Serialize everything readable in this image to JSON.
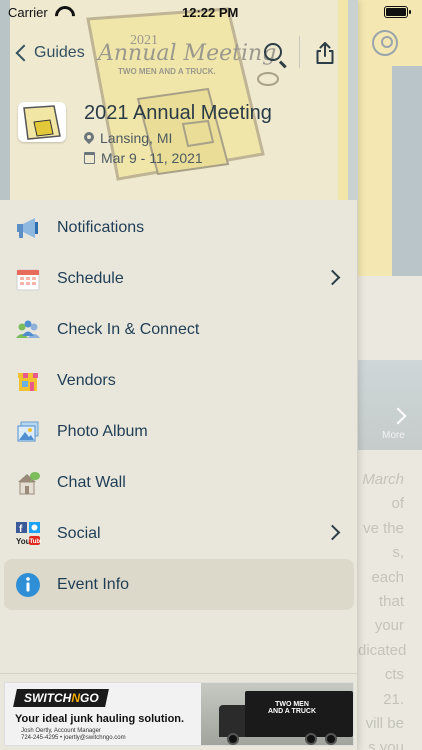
{
  "status_bar": {
    "carrier": "Carrier",
    "time": "12:22 PM"
  },
  "header": {
    "back_label": "Guides",
    "watermark_year": "2021",
    "watermark_title": "Annual Meeting",
    "watermark_sub": "TWO MEN AND A TRUCK.",
    "event_title": "2021 Annual Meeting",
    "event_location": "Lansing, MI",
    "event_dates": "Mar 9 - 11, 2021"
  },
  "menu": {
    "items": [
      {
        "label": "Notifications",
        "icon": "megaphone-icon",
        "chevron": false
      },
      {
        "label": "Schedule",
        "icon": "calendar-icon",
        "chevron": true
      },
      {
        "label": "Check In & Connect",
        "icon": "people-icon",
        "chevron": false
      },
      {
        "label": "Vendors",
        "icon": "storefront-icon",
        "chevron": false
      },
      {
        "label": "Photo Album",
        "icon": "photo-icon",
        "chevron": false
      },
      {
        "label": "Chat Wall",
        "icon": "chat-house-icon",
        "chevron": false
      },
      {
        "label": "Social",
        "icon": "social-icons",
        "chevron": true
      },
      {
        "label": "Event Info",
        "icon": "info-icon",
        "chevron": false,
        "active": true
      }
    ]
  },
  "ad": {
    "brand_part1": "SWITCH",
    "brand_part2": "N",
    "brand_part3": "GO",
    "tagline": "Your ideal junk hauling solution.",
    "contact_line1": "Josh Oertly, Account Manager",
    "contact_line2": "724-245-4295  •  joertly@switchngo.com",
    "truck_text": "TWO MEN AND A TRUCK"
  },
  "background": {
    "more_label": "More",
    "text_fragments": [
      "March",
      "of",
      "ve the",
      "s, each",
      "that",
      "your",
      "dicated",
      "cts",
      "21.",
      "vill be",
      "s you",
      "year"
    ]
  },
  "colors": {
    "accent_blue": "#2f8fd6",
    "text_navy": "#1f3d55",
    "header_cream": "#efe9d0"
  }
}
